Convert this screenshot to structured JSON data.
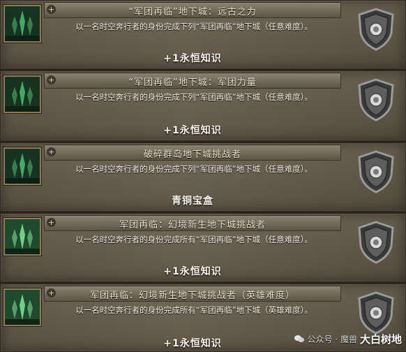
{
  "achievements": [
    {
      "title": "“军团再临”地下城：远古之力",
      "description": "以一名时空奔行者的身份完成下列“军团再临”地下城（任意难度）。",
      "reward": "+1永恒知识",
      "icon": "legion-dungeon-icon"
    },
    {
      "title": "“军团再临”地下城：军团力量",
      "description": "以一名时空奔行者的身份完成下列“军团再临”地下城（任意难度）。",
      "reward": "+1永恒知识",
      "icon": "legion-dungeon-icon"
    },
    {
      "title": "破碎群岛地下城挑战者",
      "description": "以一名时空奔行者的身份完成下列“军团再临”地下城（任意难度）。",
      "reward": "青铜宝盒",
      "icon": "legion-dungeon-icon"
    },
    {
      "title": "军团再临：幻境新生地下城挑战者",
      "description": "以一名时空奔行者的身份完成所有“军团再临”地下城（任意难度）。",
      "reward": "+1永恒知识",
      "icon": "legion-remix-dungeon-icon"
    },
    {
      "title": "军团再临：幻境新生地下城挑战者（英雄难度）",
      "description": "以一名时空奔行者的身份完成所有“军团再临”地下城（英雄难度）。",
      "reward": "+1永恒知识",
      "icon": "legion-remix-dungeon-icon"
    }
  ],
  "watermark": {
    "text": "公众号 · 魔兽",
    "brand": "大白树地",
    "icon": "wechat-icon"
  },
  "colors": {
    "panel": "#6b6150",
    "title_bar": "#8b8272",
    "icon_frame": "#8a7a58",
    "text": "#f1ece0"
  }
}
